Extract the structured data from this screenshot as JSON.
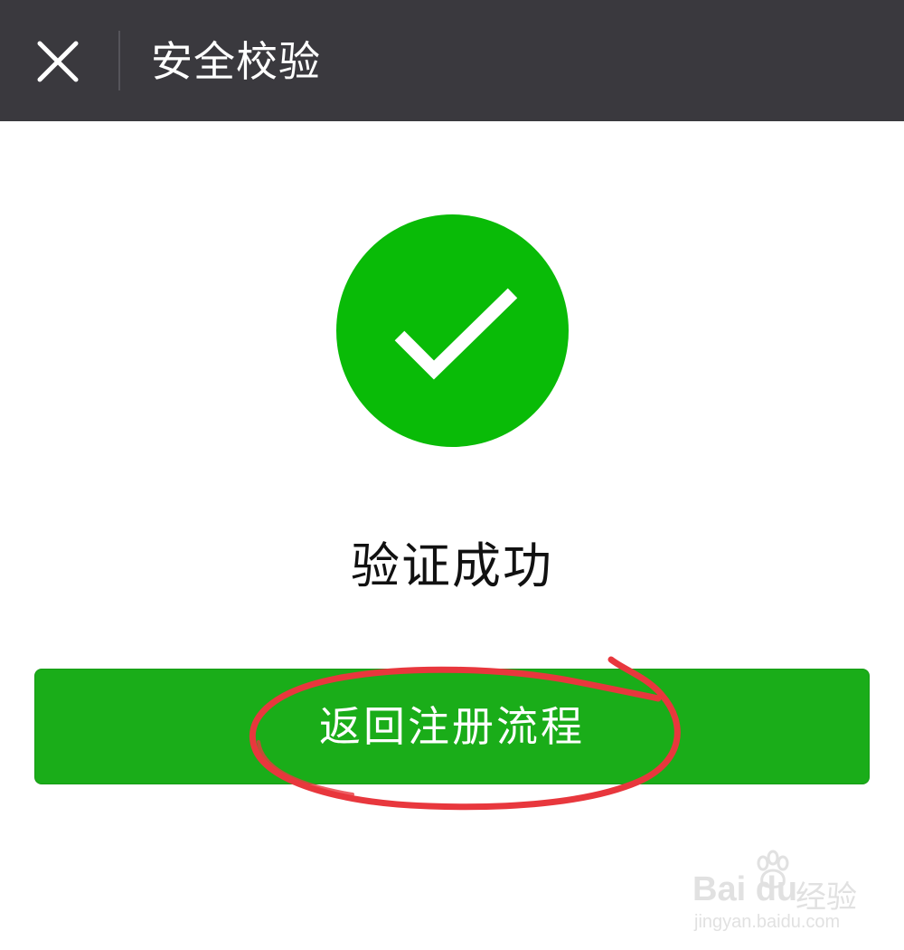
{
  "header": {
    "title": "安全校验",
    "close_icon": "close-icon",
    "background_color": "#3a393e"
  },
  "result": {
    "icon": "check-circle-icon",
    "icon_color": "#09bb07",
    "status_text": "验证成功"
  },
  "primary_button": {
    "label": "返回注册流程",
    "color": "#1aad19"
  },
  "annotation": {
    "shape": "hand-drawn-circle",
    "color": "#e8373d"
  },
  "watermark": {
    "brand": "Bai du",
    "brand_cn": "经验",
    "url": "jingyan.baidu.com"
  }
}
